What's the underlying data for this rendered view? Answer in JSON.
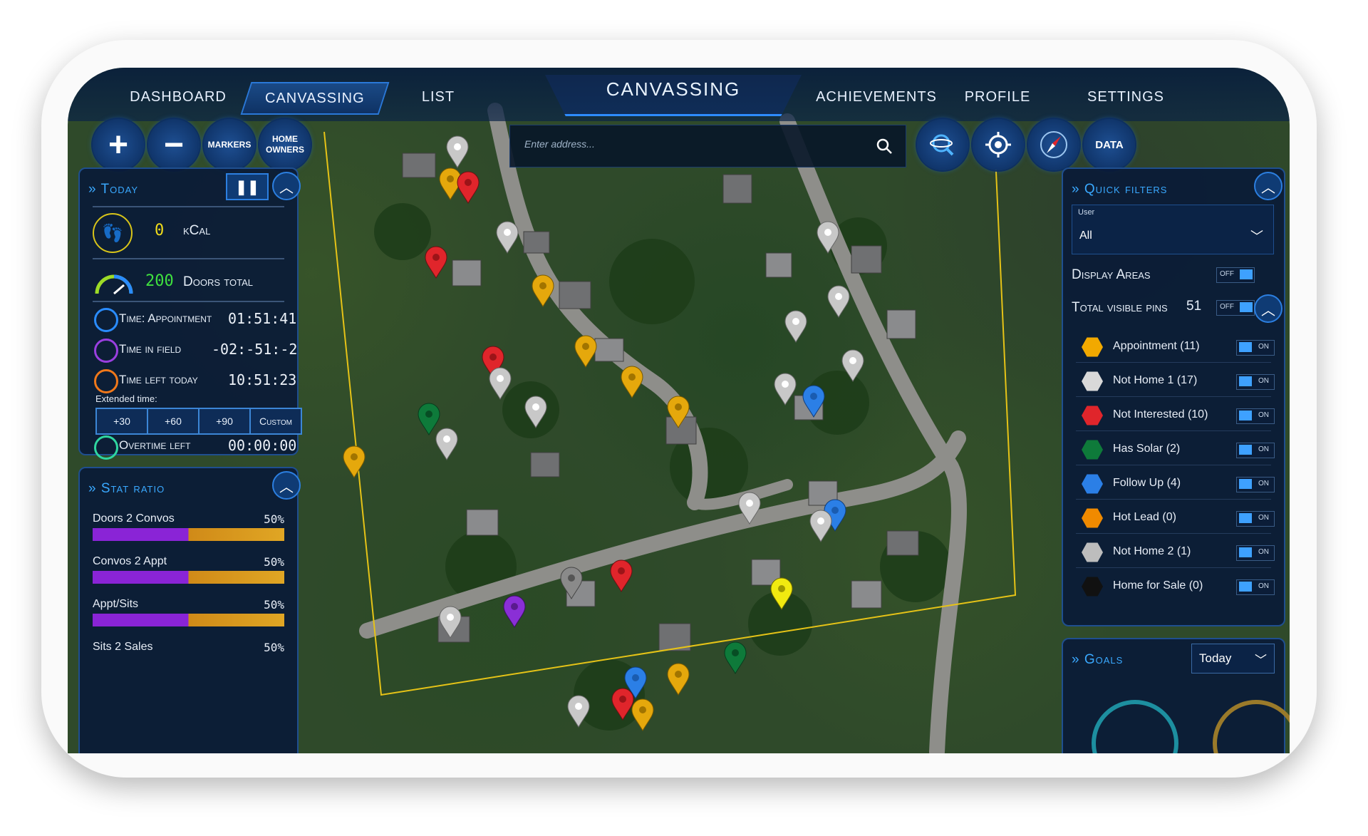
{
  "nav": {
    "tabs": [
      {
        "label": "DASHBOARD"
      },
      {
        "label": "CANVASSING"
      },
      {
        "label": "LIST"
      },
      {
        "label": "ACHIEVEMENTS"
      },
      {
        "label": "PROFILE"
      },
      {
        "label": "SETTINGS"
      }
    ],
    "title": "CANVASSING"
  },
  "controls": {
    "zoom_in": "+",
    "zoom_out": "−",
    "markers": "MARKERS",
    "home_owners_1": "HOME",
    "home_owners_2": "OWNERS",
    "data": "DATA"
  },
  "search": {
    "placeholder": "Enter address..."
  },
  "today": {
    "heading": "Today",
    "kcal_value": "0",
    "kcal_label": "kCal",
    "doors_value": "200",
    "doors_label": "Doors total",
    "appointment_label": "Time: Appointment",
    "appointment_value": "01:51:41",
    "field_label": "Time in field",
    "field_value": "-02:-51:-2",
    "left_label": "Time left today",
    "left_value": "10:51:23",
    "extended_label": "Extended time:",
    "ext_buttons": [
      "+30",
      "+60",
      "+90",
      "Custom"
    ],
    "overtime_label": "Overtime left",
    "overtime_value": "00:00:00"
  },
  "stat_ratio": {
    "heading": "Stat ratio",
    "rows": [
      {
        "label": "Doors 2 Convos",
        "pct": "50%",
        "value": 0.5
      },
      {
        "label": "Convos 2 Appt",
        "pct": "50%",
        "value": 0.5
      },
      {
        "label": "Appt/Sits",
        "pct": "50%",
        "value": 0.5
      },
      {
        "label": "Sits 2 Sales",
        "pct": "50%",
        "value": 0.5
      }
    ]
  },
  "quick_filters": {
    "heading": "Quick filters",
    "user_label": "User",
    "user_value": "All",
    "display_areas": "Display Areas",
    "display_areas_toggle": "OFF",
    "total_pins_label": "Total visible pins",
    "total_pins_value": "51",
    "total_pins_toggle": "OFF",
    "filters": [
      {
        "label": "Appointment (11)",
        "color": "#f2a900",
        "toggle": "ON"
      },
      {
        "label": "Not Home 1 (17)",
        "color": "#d9d9d9",
        "toggle": "ON"
      },
      {
        "label": "Not Interested (10)",
        "color": "#e0252b",
        "toggle": "ON"
      },
      {
        "label": "Has Solar (2)",
        "color": "#0e7a3a",
        "toggle": "ON"
      },
      {
        "label": "Follow Up (4)",
        "color": "#2b7fe6",
        "toggle": "ON"
      },
      {
        "label": "Hot Lead (0)",
        "color": "#f08a00",
        "toggle": "ON"
      },
      {
        "label": "Not Home 2 (1)",
        "color": "#bdbdbd",
        "toggle": "ON"
      },
      {
        "label": "Home for Sale (0)",
        "color": "#111111",
        "toggle": "ON"
      }
    ]
  },
  "goals": {
    "heading": "Goals",
    "period": "Today"
  },
  "colors": {
    "accent": "#2e8cff",
    "panel": "#091a37",
    "heading": "#3aa9ff"
  }
}
